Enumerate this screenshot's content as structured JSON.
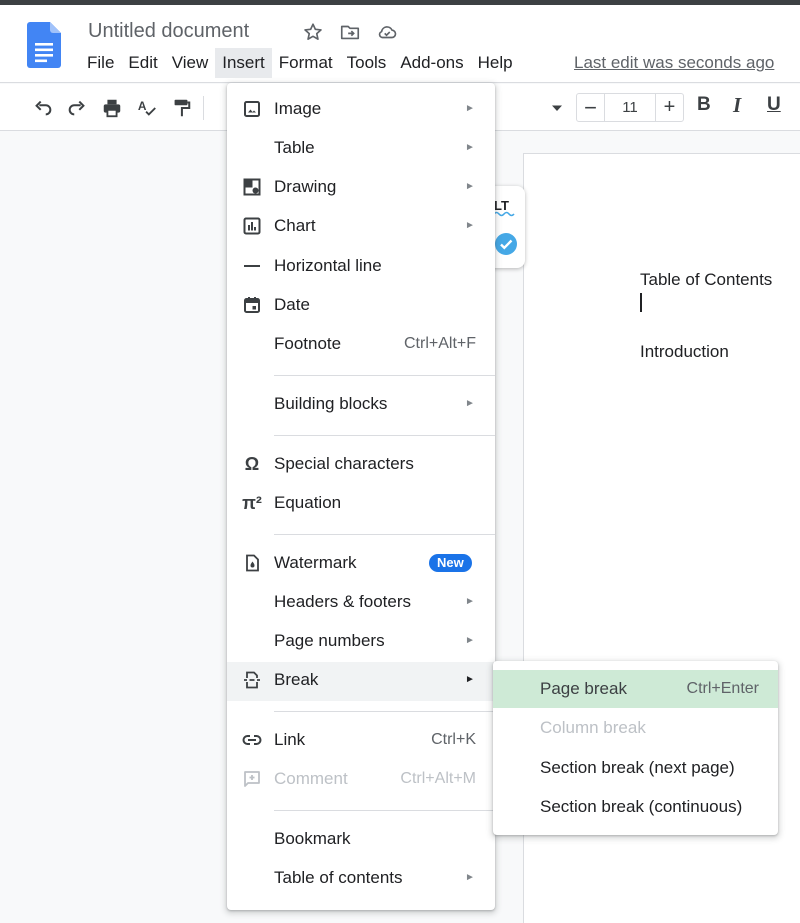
{
  "app": {
    "doc_title": "Untitled document",
    "last_edit": "Last edit was seconds ago"
  },
  "menubar": {
    "items": [
      "File",
      "Edit",
      "View",
      "Insert",
      "Format",
      "Tools",
      "Add-ons",
      "Help"
    ],
    "active": "Insert"
  },
  "toolbar": {
    "font_size": "11",
    "size_minus": "−",
    "size_plus": "+",
    "bold": "B",
    "italic": "I",
    "underline": "U"
  },
  "document": {
    "lines": [
      "Table of Contents",
      "Introduction"
    ]
  },
  "insert_menu": {
    "items": [
      {
        "label": "Image",
        "icon": "image-icon",
        "submenu": true
      },
      {
        "label": "Table",
        "submenu": true
      },
      {
        "label": "Drawing",
        "icon": "drawing-icon",
        "submenu": true
      },
      {
        "label": "Chart",
        "icon": "chart-icon",
        "submenu": true
      },
      {
        "label": "Horizontal line",
        "icon": "horizontal-line-icon"
      },
      {
        "label": "Date",
        "icon": "date-icon"
      },
      {
        "label": "Footnote",
        "shortcut": "Ctrl+Alt+F"
      },
      {
        "label": "Building blocks",
        "submenu": true
      },
      {
        "label": "Special characters",
        "icon": "omega-icon"
      },
      {
        "label": "Equation",
        "icon": "pi-icon"
      },
      {
        "label": "Watermark",
        "icon": "watermark-icon",
        "badge": "New"
      },
      {
        "label": "Headers & footers",
        "submenu": true
      },
      {
        "label": "Page numbers",
        "submenu": true
      },
      {
        "label": "Break",
        "icon": "break-icon",
        "submenu": true,
        "highlighted": true
      },
      {
        "label": "Link",
        "icon": "link-icon",
        "shortcut": "Ctrl+K"
      },
      {
        "label": "Comment",
        "icon": "comment-icon",
        "shortcut": "Ctrl+Alt+M",
        "disabled": true
      },
      {
        "label": "Bookmark"
      },
      {
        "label": "Table of contents",
        "submenu": true
      }
    ]
  },
  "break_submenu": {
    "items": [
      {
        "label": "Page break",
        "shortcut": "Ctrl+Enter",
        "highlighted": true
      },
      {
        "label": "Column break",
        "disabled": true
      },
      {
        "label": "Section break (next page)"
      },
      {
        "label": "Section break (continuous)"
      }
    ]
  },
  "colors": {
    "docs_blue": "#4285f4",
    "badge_blue": "#1a73e8",
    "submenu_highlight": "#ceead6",
    "menu_highlight": "#f1f3f4"
  }
}
